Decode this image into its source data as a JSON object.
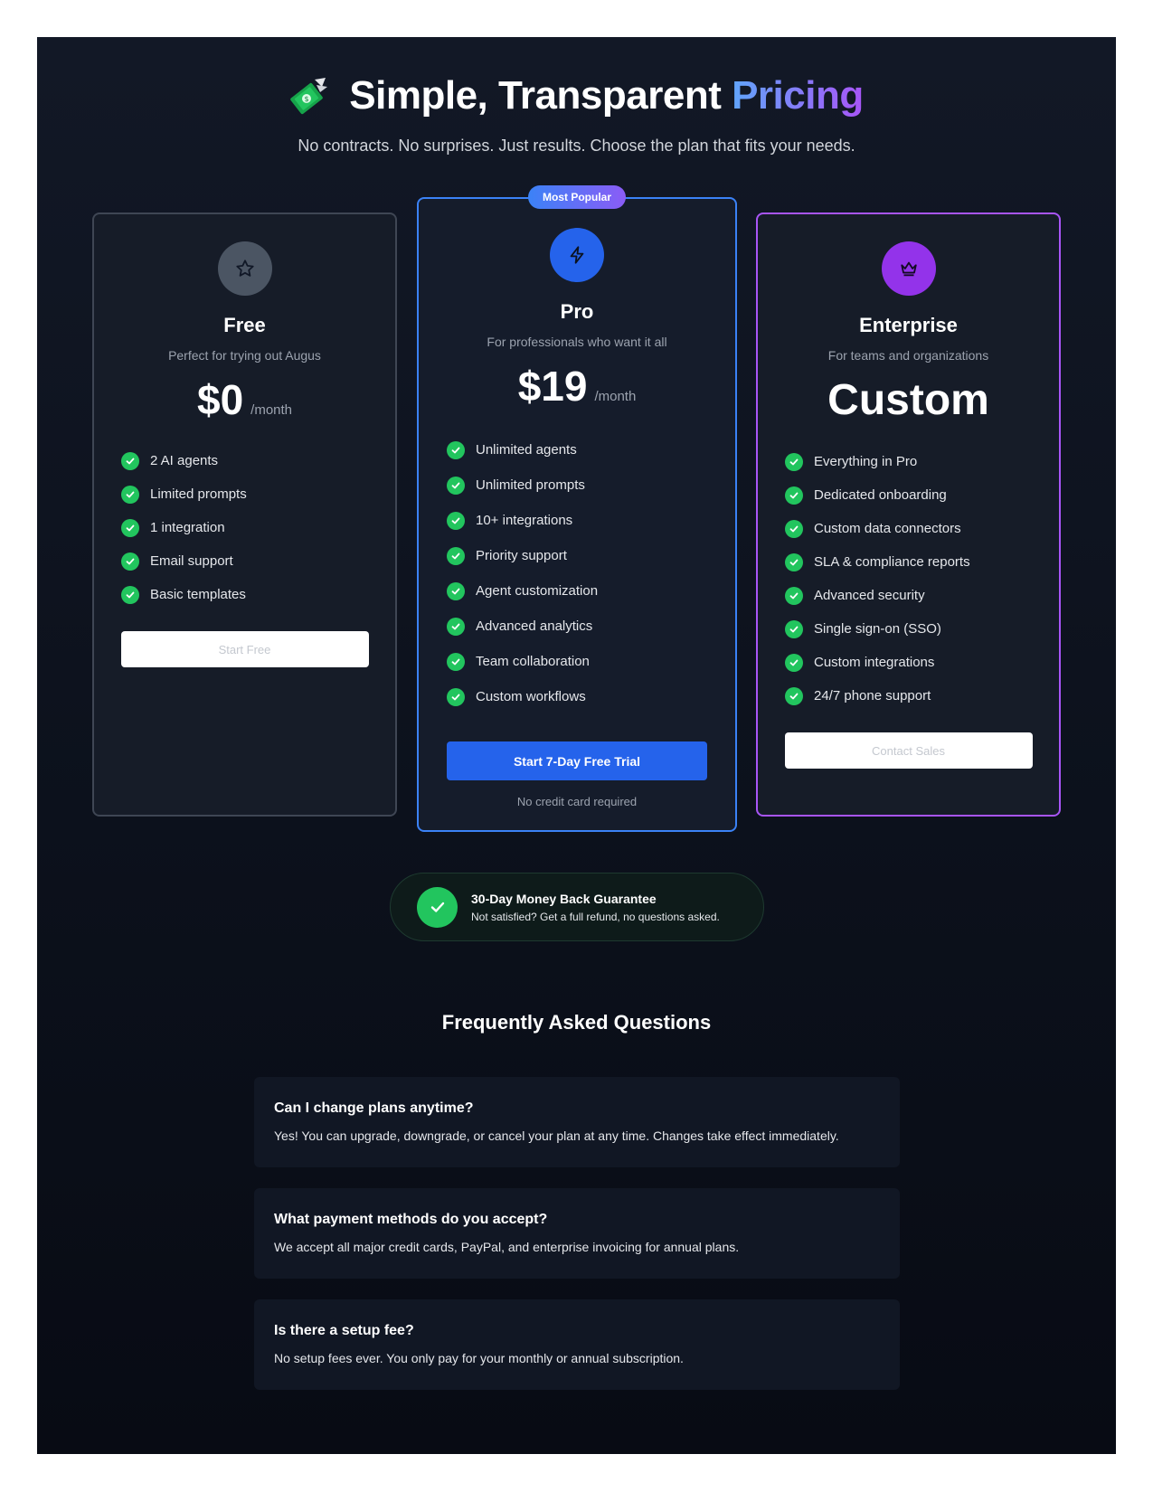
{
  "hero": {
    "icon": "money-with-wings-icon",
    "title_main": "Simple, Transparent",
    "title_accent": "Pricing",
    "subtitle": "No contracts. No surprises. Just results. Choose the plan that fits your needs."
  },
  "plans": {
    "free": {
      "icon": "star-icon",
      "name": "Free",
      "description": "Perfect for trying out Augus",
      "price": "$0",
      "period": "/month",
      "features": [
        "2 AI agents",
        "Limited prompts",
        "1 integration",
        "Email support",
        "Basic templates"
      ],
      "cta": "Start Free"
    },
    "pro": {
      "badge": "Most Popular",
      "icon": "lightning-icon",
      "name": "Pro",
      "description": "For professionals who want it all",
      "price": "$19",
      "period": "/month",
      "features": [
        "Unlimited agents",
        "Unlimited prompts",
        "10+ integrations",
        "Priority support",
        "Agent customization",
        "Advanced analytics",
        "Team collaboration",
        "Custom workflows"
      ],
      "cta": "Start 7-Day Free Trial",
      "note": "No credit card required"
    },
    "enterprise": {
      "icon": "crown-icon",
      "name": "Enterprise",
      "description": "For teams and organizations",
      "price": "Custom",
      "features": [
        "Everything in Pro",
        "Dedicated onboarding",
        "Custom data connectors",
        "SLA & compliance reports",
        "Advanced security",
        "Single sign-on (SSO)",
        "Custom integrations",
        "24/7 phone support"
      ],
      "cta": "Contact Sales"
    }
  },
  "guarantee": {
    "title": "30-Day Money Back Guarantee",
    "text": "Not satisfied? Get a full refund, no questions asked."
  },
  "faq": {
    "heading": "Frequently Asked Questions",
    "items": [
      {
        "q": "Can I change plans anytime?",
        "a": "Yes! You can upgrade, downgrade, or cancel your plan at any time. Changes take effect immediately."
      },
      {
        "q": "What payment methods do you accept?",
        "a": "We accept all major credit cards, PayPal, and enterprise invoicing for annual plans."
      },
      {
        "q": "Is there a setup fee?",
        "a": "No setup fees ever. You only pay for your monthly or annual subscription."
      }
    ]
  },
  "colors": {
    "background": "#0c111c",
    "pro_accent": "#3b82f6",
    "enterprise_accent": "#a855f7",
    "check_green": "#22c55e"
  }
}
